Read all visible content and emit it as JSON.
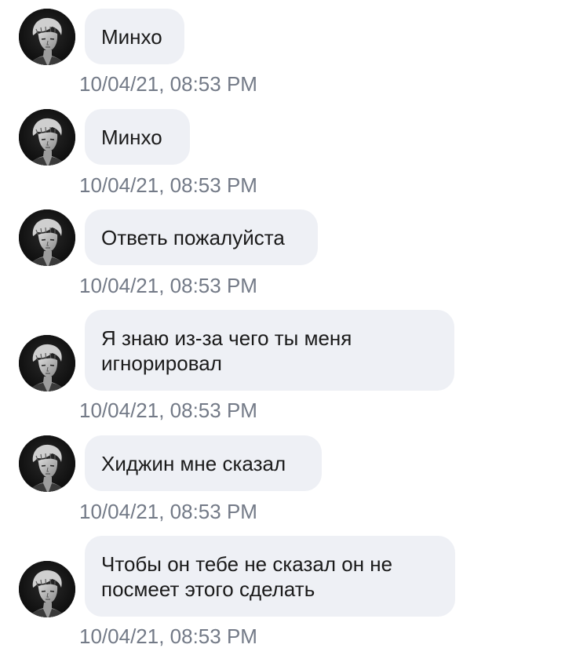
{
  "messages": [
    {
      "sender_avatar": "avatar-portrait-icon",
      "text": "Минхо",
      "timestamp": "10/04/21, 08:53 PM"
    },
    {
      "sender_avatar": "avatar-portrait-icon",
      "text": "Минхо",
      "timestamp": "10/04/21, 08:53 PM"
    },
    {
      "sender_avatar": "avatar-portrait-icon",
      "text": "Ответь пожалуйста",
      "timestamp": "10/04/21, 08:53 PM"
    },
    {
      "sender_avatar": "avatar-portrait-icon",
      "text": "Я знаю из-за чего ты меня\nигнорировал",
      "timestamp": "10/04/21, 08:53 PM"
    },
    {
      "sender_avatar": "avatar-portrait-icon",
      "text": "Хиджин мне сказал",
      "timestamp": "10/04/21, 08:53 PM"
    },
    {
      "sender_avatar": "avatar-portrait-icon",
      "text": "Чтобы он тебе не сказал он не\nпосмеет этого сделать",
      "timestamp": "10/04/21, 08:53 PM"
    }
  ],
  "colors": {
    "bubble_bg": "#eef0f5",
    "message_text": "#1a1a1a",
    "timestamp_text": "#737a87",
    "background": "#ffffff"
  }
}
